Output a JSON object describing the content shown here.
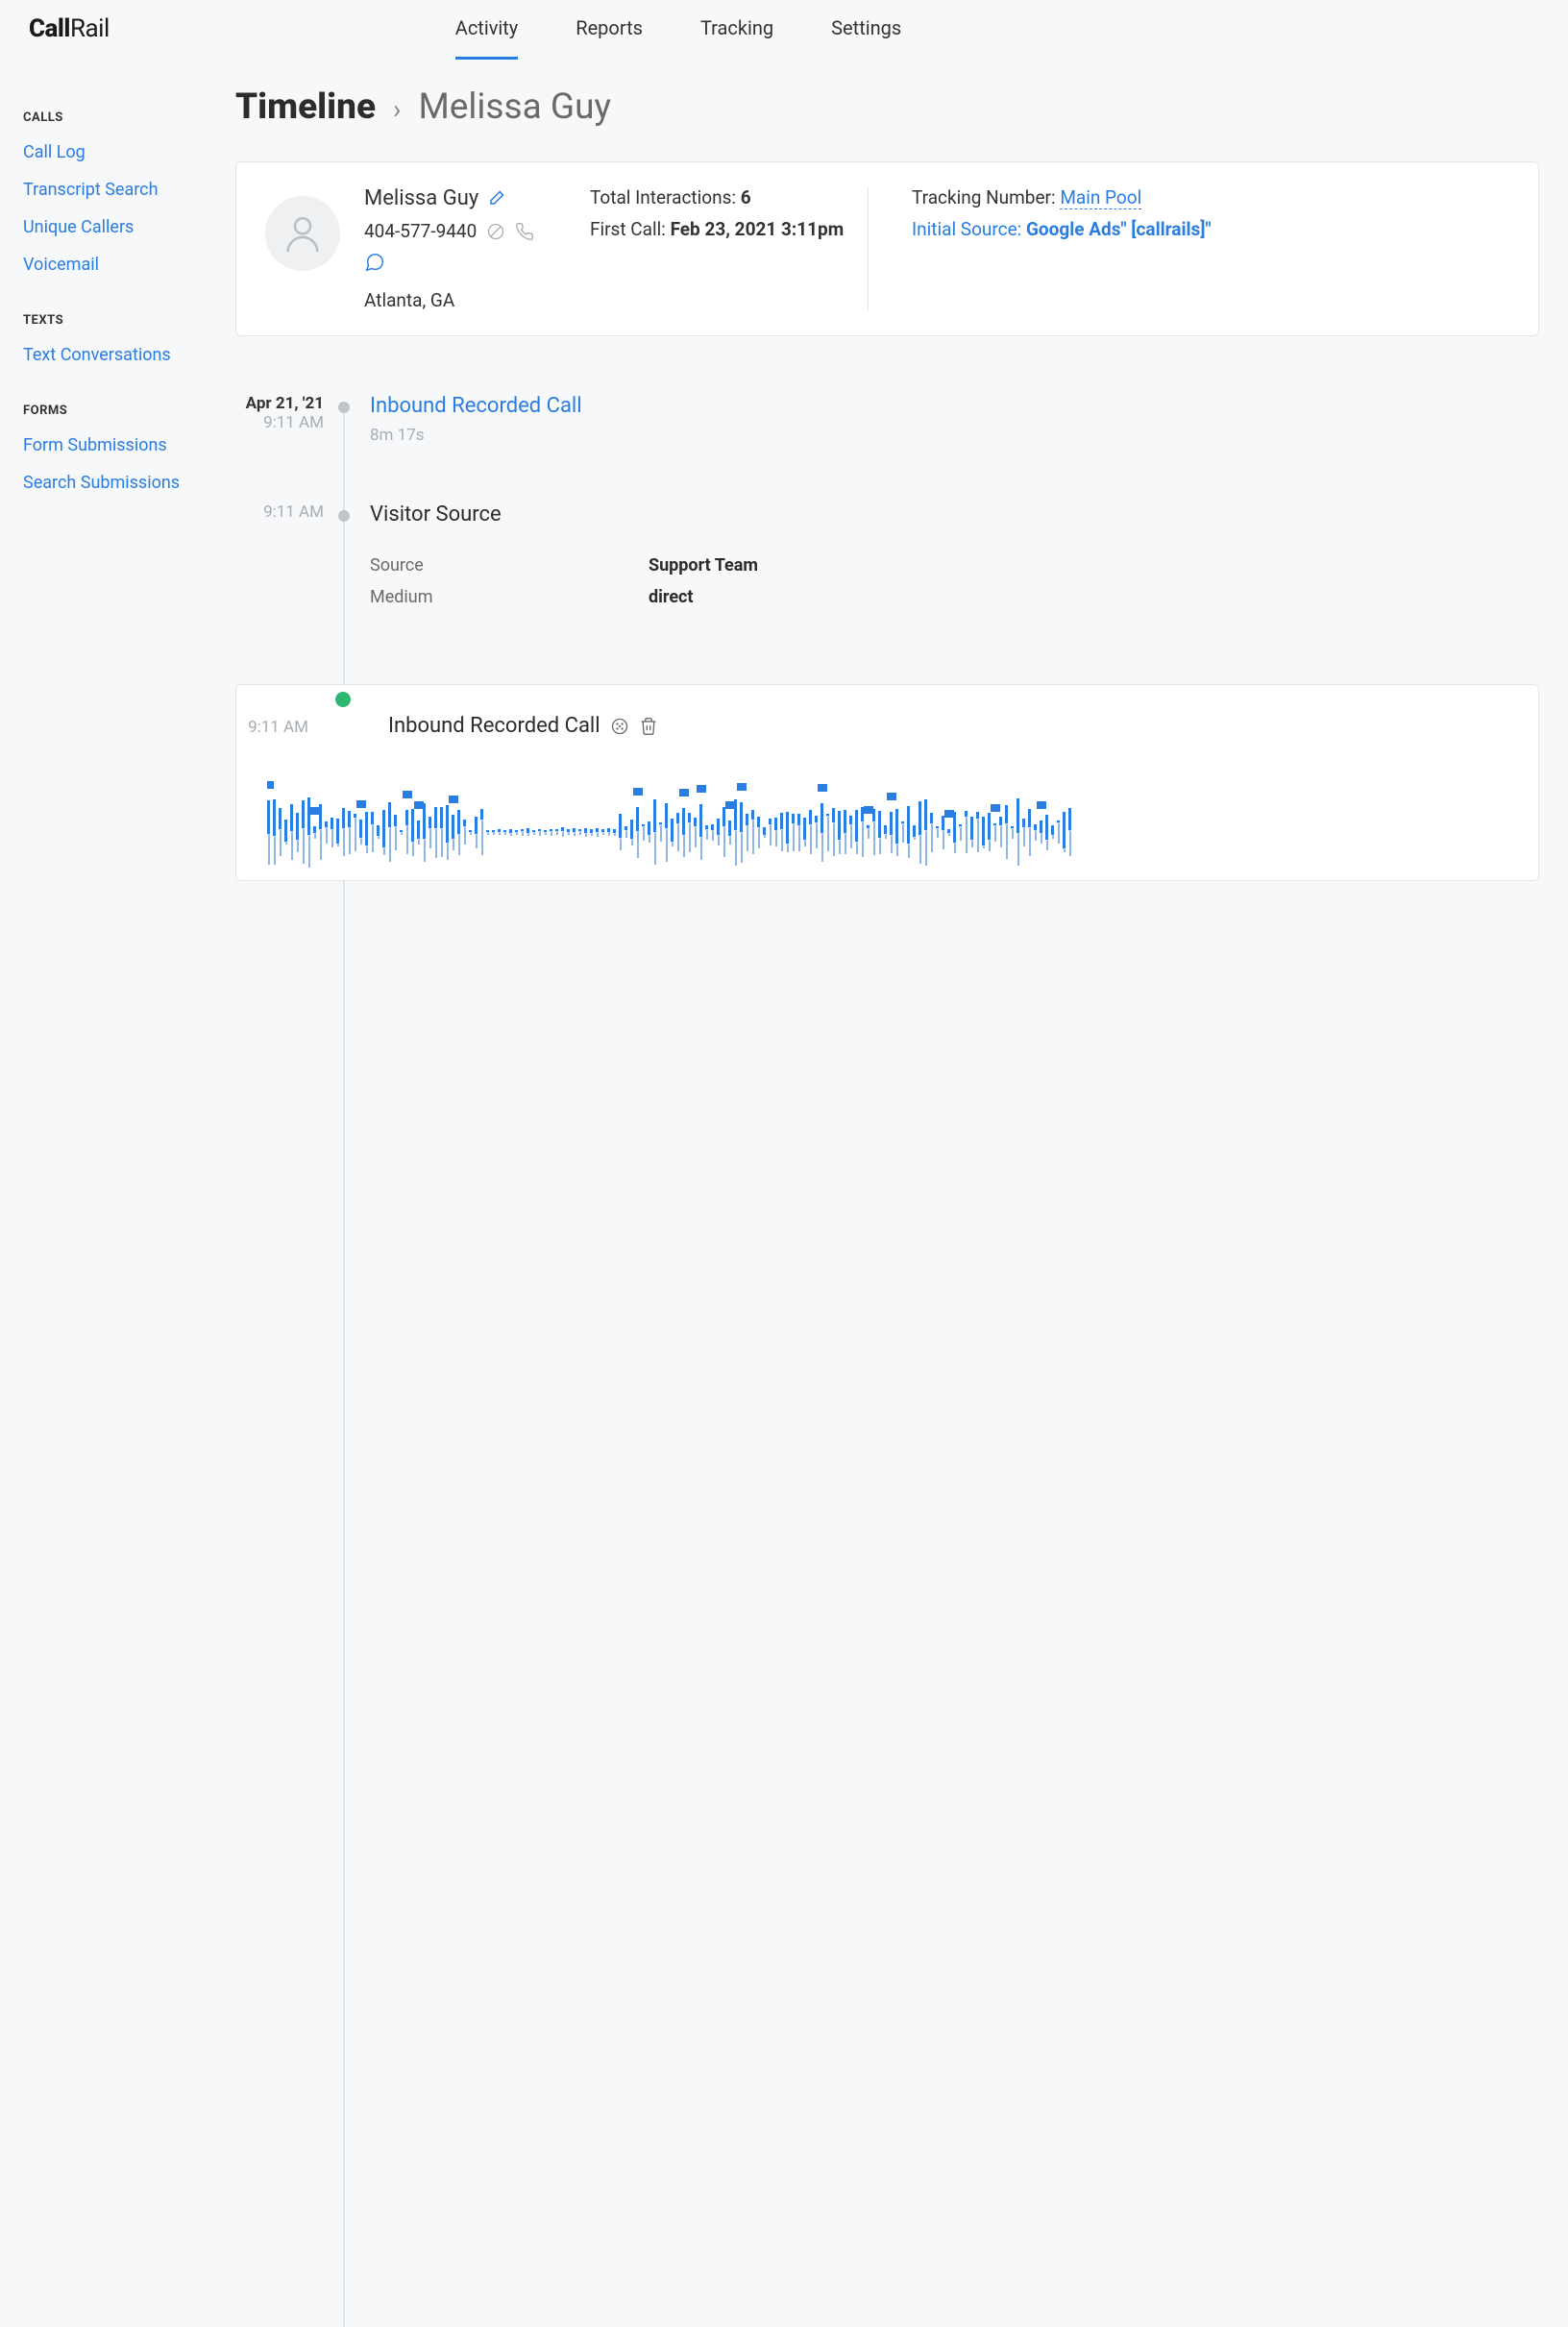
{
  "logo": {
    "bold": "Call",
    "rest": "Rail"
  },
  "topnav": [
    "Activity",
    "Reports",
    "Tracking",
    "Settings"
  ],
  "sidebar": {
    "groups": [
      {
        "heading": "CALLS",
        "items": [
          "Call Log",
          "Transcript Search",
          "Unique Callers",
          "Voicemail"
        ]
      },
      {
        "heading": "TEXTS",
        "items": [
          "Text Conversations"
        ]
      },
      {
        "heading": "FORMS",
        "items": [
          "Form Submissions",
          "Search Submissions"
        ]
      }
    ]
  },
  "breadcrumb": {
    "title": "Timeline",
    "name": "Melissa Guy"
  },
  "contact": {
    "name": "Melissa Guy",
    "phone": "404-577-9440",
    "location": "Atlanta, GA",
    "total_label": "Total Interactions: ",
    "total_value": "6",
    "first_label": "First Call: ",
    "first_value": "Feb 23, 2021 3:11pm",
    "tracking_label": "Tracking Number: ",
    "tracking_value": "Main Pool",
    "source_label": "Initial Source: ",
    "source_value": "Google Ads\" [callrails]\""
  },
  "timeline": [
    {
      "date": "Apr 21, '21",
      "time": "9:11 AM",
      "title": "Inbound Recorded Call",
      "duration": "8m 17s",
      "link": true
    },
    {
      "time": "9:11 AM",
      "title": "Visitor Source",
      "rows": [
        {
          "k": "Source",
          "v": "Support Team"
        },
        {
          "k": "Medium",
          "v": "direct"
        }
      ]
    },
    {
      "time": "9:11 AM",
      "title": "Inbound Recorded Call",
      "recording": true
    }
  ]
}
